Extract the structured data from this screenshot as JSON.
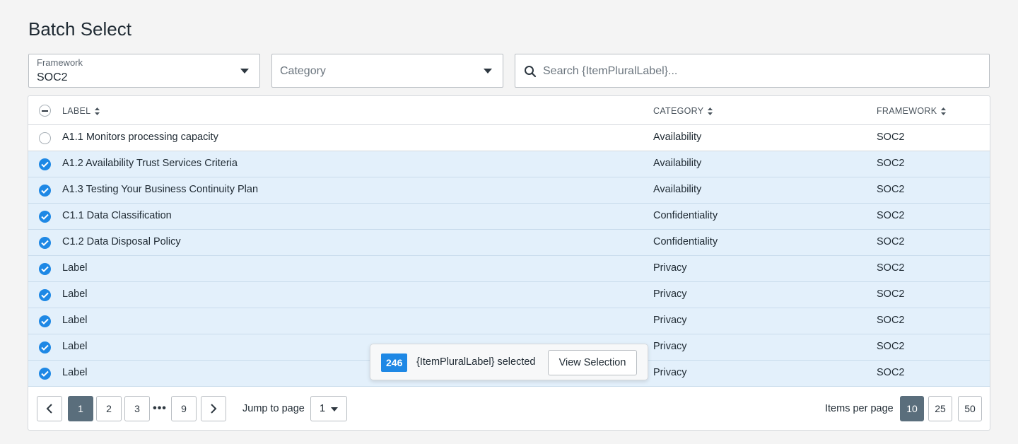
{
  "page": {
    "title": "Batch Select"
  },
  "filters": {
    "framework": {
      "label": "Framework",
      "value": "SOC2"
    },
    "category": {
      "placeholder": "Category"
    },
    "search": {
      "placeholder": "Search {ItemPluralLabel}..."
    }
  },
  "table": {
    "headers": {
      "label": "LABEL",
      "category": "CATEGORY",
      "framework": "FRAMEWORK"
    },
    "rows": [
      {
        "label": "A1.1 Monitors processing capacity",
        "category": "Availability",
        "framework": "SOC2",
        "selected": false
      },
      {
        "label": "A1.2 Availability Trust Services Criteria",
        "category": "Availability",
        "framework": "SOC2",
        "selected": true
      },
      {
        "label": "A1.3 Testing Your Business Continuity Plan",
        "category": "Availability",
        "framework": "SOC2",
        "selected": true
      },
      {
        "label": "C1.1 Data Classification",
        "category": "Confidentiality",
        "framework": "SOC2",
        "selected": true
      },
      {
        "label": "C1.2 Data Disposal Policy",
        "category": "Confidentiality",
        "framework": "SOC2",
        "selected": true
      },
      {
        "label": "Label",
        "category": "Privacy",
        "framework": "SOC2",
        "selected": true
      },
      {
        "label": "Label",
        "category": "Privacy",
        "framework": "SOC2",
        "selected": true
      },
      {
        "label": "Label",
        "category": "Privacy",
        "framework": "SOC2",
        "selected": true
      },
      {
        "label": "Label",
        "category": "Privacy",
        "framework": "SOC2",
        "selected": true
      },
      {
        "label": "Label",
        "category": "Privacy",
        "framework": "SOC2",
        "selected": true
      }
    ]
  },
  "pagination": {
    "pages": [
      "1",
      "2",
      "3",
      "9"
    ],
    "current_page": "1",
    "ellipsis": "•••",
    "jump_label": "Jump to page",
    "jump_value": "1",
    "items_per_page_label": "Items per page",
    "items_per_page_options": [
      "10",
      "25",
      "50"
    ],
    "items_per_page_selected": "10"
  },
  "selection_toast": {
    "count": "246",
    "message": "{ItemPluralLabel} selected",
    "button_label": "View Selection"
  },
  "colors": {
    "accent": "#1e88e5",
    "selected_row": "#e3f0fb",
    "active_page": "#5a6e7c"
  }
}
